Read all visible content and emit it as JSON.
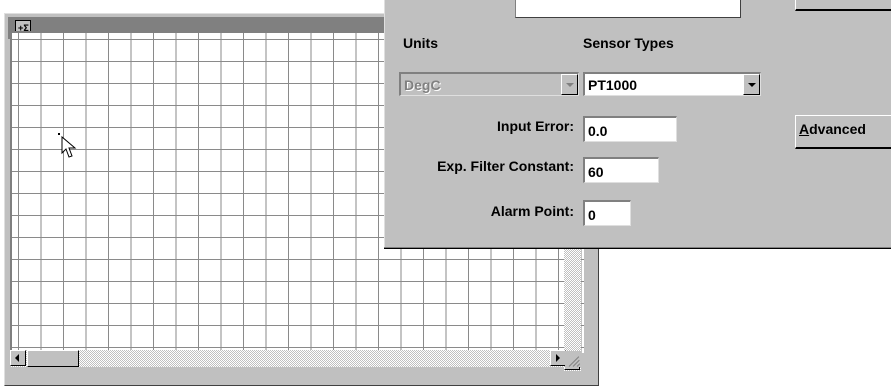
{
  "grid_window": {
    "system_icon": "window-system-menu-icon",
    "system_icon_glyph": "+Σ",
    "cursor_icon": "arrow-cursor-icon"
  },
  "config": {
    "units_label": "Units",
    "sensor_types_label": "Sensor Types",
    "units_value": "DegC",
    "sensor_type_value": "PT1000",
    "input_error_label": "Input Error:",
    "input_error_value": "0.0",
    "filter_label": "Exp. Filter Constant:",
    "filter_value": "60",
    "alarm_label": "Alarm Point:",
    "alarm_value": "0",
    "advanced_button_mnemonic": "A",
    "advanced_button_rest": "dvanced"
  }
}
